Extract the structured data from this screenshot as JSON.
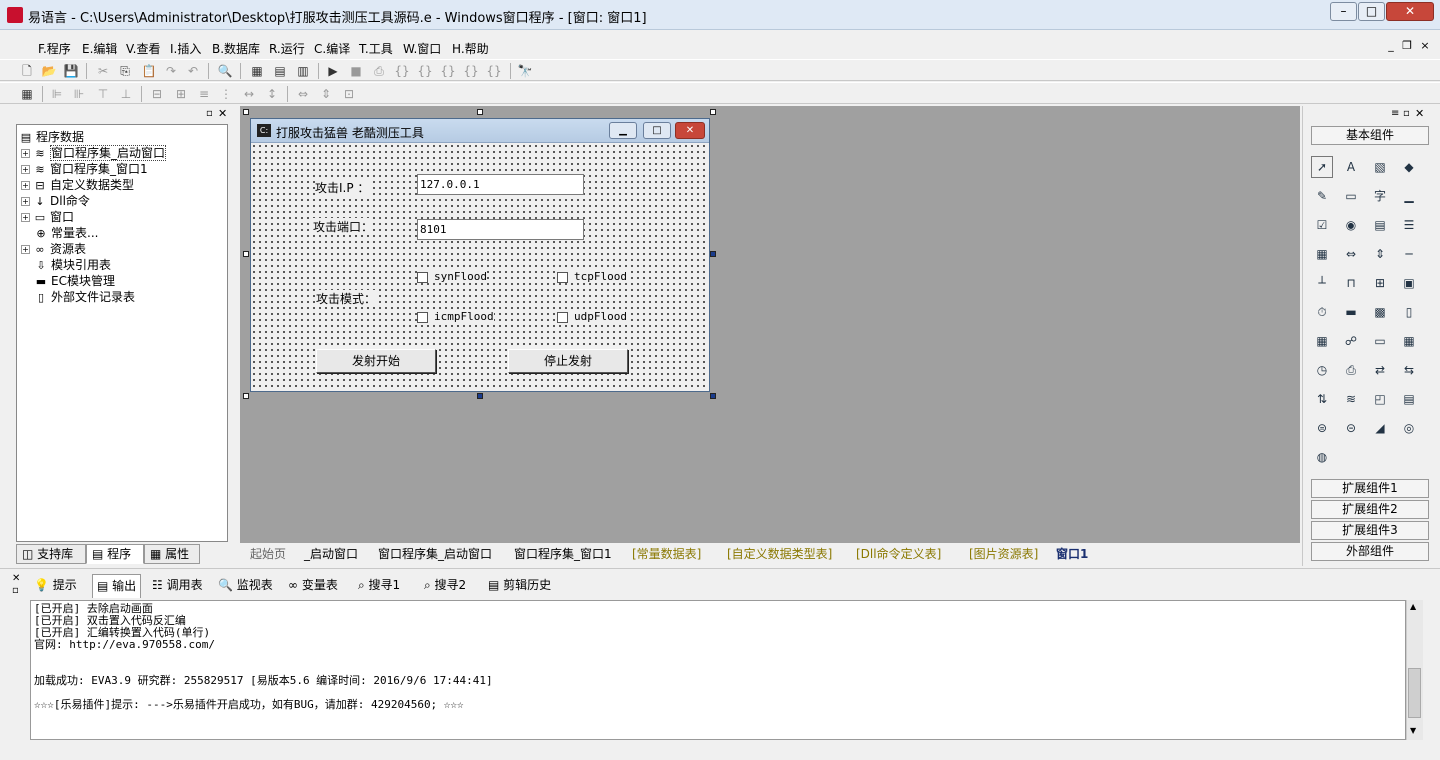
{
  "window": {
    "title": "易语言 - C:\\Users\\Administrator\\Desktop\\打服攻击测压工具源码.e - Windows窗口程序 - [窗口: 窗口1]",
    "min": "–",
    "max": "□",
    "close": "✕"
  },
  "menu": [
    "F.程序",
    "E.编辑",
    "V.查看",
    "I.插入",
    "B.数据库",
    "R.运行",
    "C.编译",
    "T.工具",
    "W.窗口",
    "H.帮助"
  ],
  "mdi_controls": [
    "_",
    "❐",
    "×"
  ],
  "tree": {
    "root": "程序数据",
    "items": [
      "窗口程序集_启动窗口",
      "窗口程序集_窗口1",
      "自定义数据类型",
      "Dll命令",
      "窗口",
      "常量表...",
      "资源表",
      "模块引用表",
      "EC模块管理",
      "外部文件记录表"
    ]
  },
  "left_tabs": [
    "支持库",
    "程序",
    "属性"
  ],
  "form": {
    "title": "打服攻击猛兽 老酷测压工具",
    "ip_label": "攻击I.P ：",
    "ip_value": "127.0.0.1",
    "port_label": "攻击端口：",
    "port_value": "8101",
    "mode_label": "攻击模式：",
    "checks": [
      "synFlood",
      "tcpFlood",
      "icmpFlood",
      "udpFlood"
    ],
    "start_button": "发射开始",
    "stop_button": "停止发射"
  },
  "doc_tabs": [
    "起始页",
    "_启动窗口",
    "窗口程序集_启动窗口",
    "窗口程序集_窗口1",
    "[常量数据表]",
    "[自定义数据类型表]",
    "[Dll命令定义表]",
    "[图片资源表]",
    "窗口1"
  ],
  "components": {
    "header": "基本组件",
    "groups": [
      "扩展组件1",
      "扩展组件2",
      "扩展组件3",
      "外部组件"
    ],
    "icons": [
      "cursor-icon",
      "label-icon",
      "picture-icon",
      "shape-icon",
      "edit-icon",
      "frame-icon",
      "text-icon",
      "line-icon",
      "checkbox-icon",
      "radio-icon",
      "combo-icon",
      "list-icon",
      "grid-icon",
      "scrollbar-icon",
      "spin-icon",
      "slider-icon",
      "ruler-icon",
      "tab-icon",
      "tree-icon",
      "calendar-icon",
      "timer-icon",
      "status-icon",
      "folder-icon",
      "doc-icon",
      "table-icon",
      "network-icon",
      "progress-icon",
      "datetime-icon",
      "clock-icon",
      "printer-icon",
      "socket-icon",
      "server-icon",
      "client-icon",
      "pipe-icon",
      "window-icon",
      "panel-icon",
      "db-icon",
      "db2-icon",
      "chart-icon",
      "odbc-icon",
      "odbc2-icon"
    ]
  },
  "bottom_tabs": [
    "提示",
    "输出",
    "调用表",
    "监视表",
    "变量表",
    "搜寻1",
    "搜寻2",
    "剪辑历史"
  ],
  "output_lines": [
    "[已开启] 去除启动画面",
    "[已开启] 双击置入代码反汇编",
    "[已开启] 汇编转换置入代码(单行)",
    "官网: http://eva.970558.com/",
    "加载成功: EVA3.9 研究群: 255829517 [易版本5.6 编译时间: 2016/9/6 17:44:41]",
    "☆☆☆[乐易插件]提示: --->乐易插件开启成功，如有BUG，请加群: 429204560; ☆☆☆"
  ]
}
